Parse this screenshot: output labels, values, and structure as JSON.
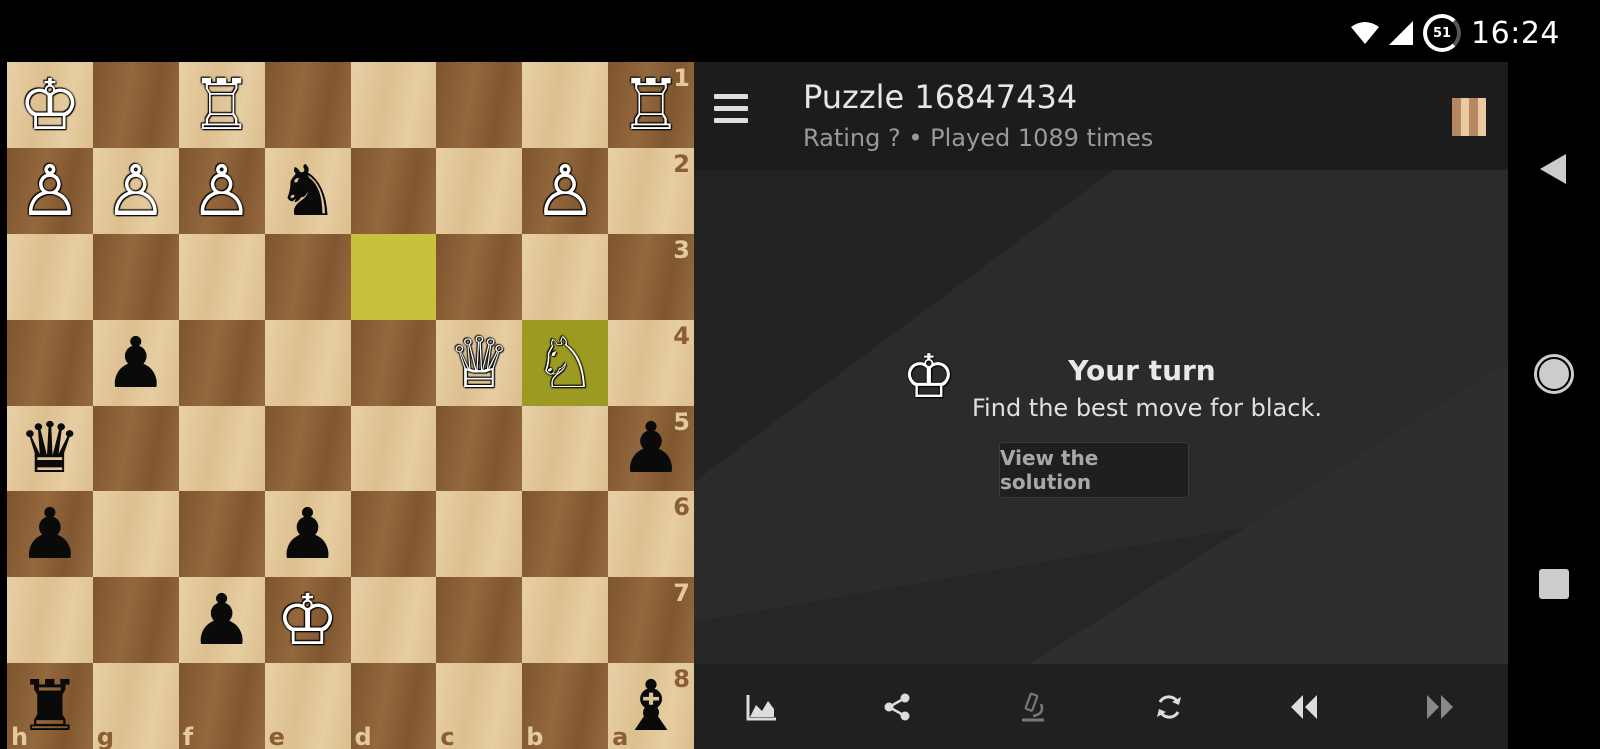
{
  "status_bar": {
    "time": "16:24",
    "battery_level": "51",
    "icons": [
      "wifi-icon",
      "signal-icon",
      "battery-icon"
    ]
  },
  "board": {
    "ranks": [
      "1",
      "2",
      "3",
      "4",
      "5",
      "6",
      "7",
      "8"
    ],
    "files": [
      "h",
      "g",
      "f",
      "e",
      "d",
      "c",
      "b",
      "a"
    ],
    "colors": {
      "light": "#e4c99a",
      "dark": "#8b5e34",
      "highlight_light": "#c7c13c",
      "highlight_dark": "#9c9a22"
    },
    "highlighted": [
      "d3",
      "b4"
    ],
    "pieces": [
      {
        "sq": "h1",
        "color": "white",
        "type": "king"
      },
      {
        "sq": "f1",
        "color": "white",
        "type": "rook"
      },
      {
        "sq": "a1",
        "color": "white",
        "type": "rook"
      },
      {
        "sq": "h2",
        "color": "white",
        "type": "pawn"
      },
      {
        "sq": "g2",
        "color": "white",
        "type": "pawn"
      },
      {
        "sq": "f2",
        "color": "white",
        "type": "pawn"
      },
      {
        "sq": "e2",
        "color": "black",
        "type": "knight"
      },
      {
        "sq": "b2",
        "color": "white",
        "type": "pawn"
      },
      {
        "sq": "g4",
        "color": "black",
        "type": "pawn"
      },
      {
        "sq": "c4",
        "color": "white",
        "type": "queen"
      },
      {
        "sq": "b4",
        "color": "white",
        "type": "knight"
      },
      {
        "sq": "h5",
        "color": "black",
        "type": "queen"
      },
      {
        "sq": "a5",
        "color": "black",
        "type": "pawn"
      },
      {
        "sq": "h6",
        "color": "black",
        "type": "pawn"
      },
      {
        "sq": "e6",
        "color": "black",
        "type": "pawn"
      },
      {
        "sq": "f7",
        "color": "black",
        "type": "pawn"
      },
      {
        "sq": "e7",
        "color": "white",
        "type": "king"
      },
      {
        "sq": "h8",
        "color": "black",
        "type": "rook"
      },
      {
        "sq": "a8",
        "color": "black",
        "type": "bishop"
      }
    ]
  },
  "toolbar": {
    "title": "Puzzle 16847434",
    "subtitle": "Rating ? • Played 1089 times"
  },
  "turn": {
    "king_glyph": "♔",
    "title": "Your turn",
    "description": "Find the best move for black.",
    "solution_button": "View the solution"
  },
  "bottom_bar": {
    "buttons": [
      "chart-icon",
      "share-icon",
      "analysis-icon",
      "flip-board-icon",
      "backward-icon",
      "forward-icon"
    ]
  }
}
